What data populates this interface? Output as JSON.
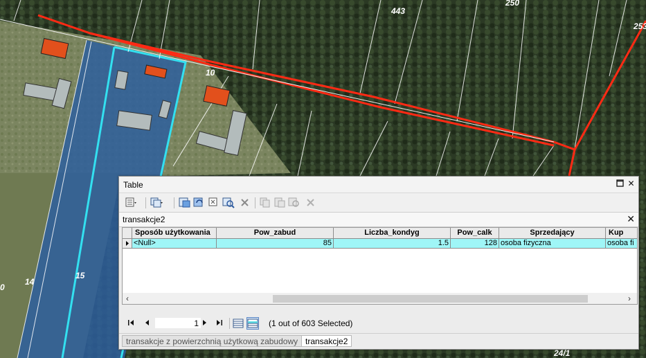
{
  "map": {
    "parcel_labels": [
      "443",
      "250",
      "253",
      "10",
      "14",
      "15",
      "24/1",
      "0"
    ]
  },
  "window": {
    "title": "Table"
  },
  "table_tab": {
    "name": "transakcje2"
  },
  "grid": {
    "columns": [
      "Sposób użytkowania",
      "Pow_zabud",
      "Liczba_kondyg",
      "Pow_calk",
      "Sprzedający",
      "Kup"
    ],
    "row": [
      "<Null>",
      "85",
      "1.5",
      "128",
      "osoba fizyczna",
      "osoba fi"
    ]
  },
  "navigation": {
    "current_record": "1",
    "status": "(1 out of 603 Selected)"
  },
  "bottom_tabs": [
    "transakcje z powierzchnią użytkową zabudowy",
    "transakcje2"
  ]
}
